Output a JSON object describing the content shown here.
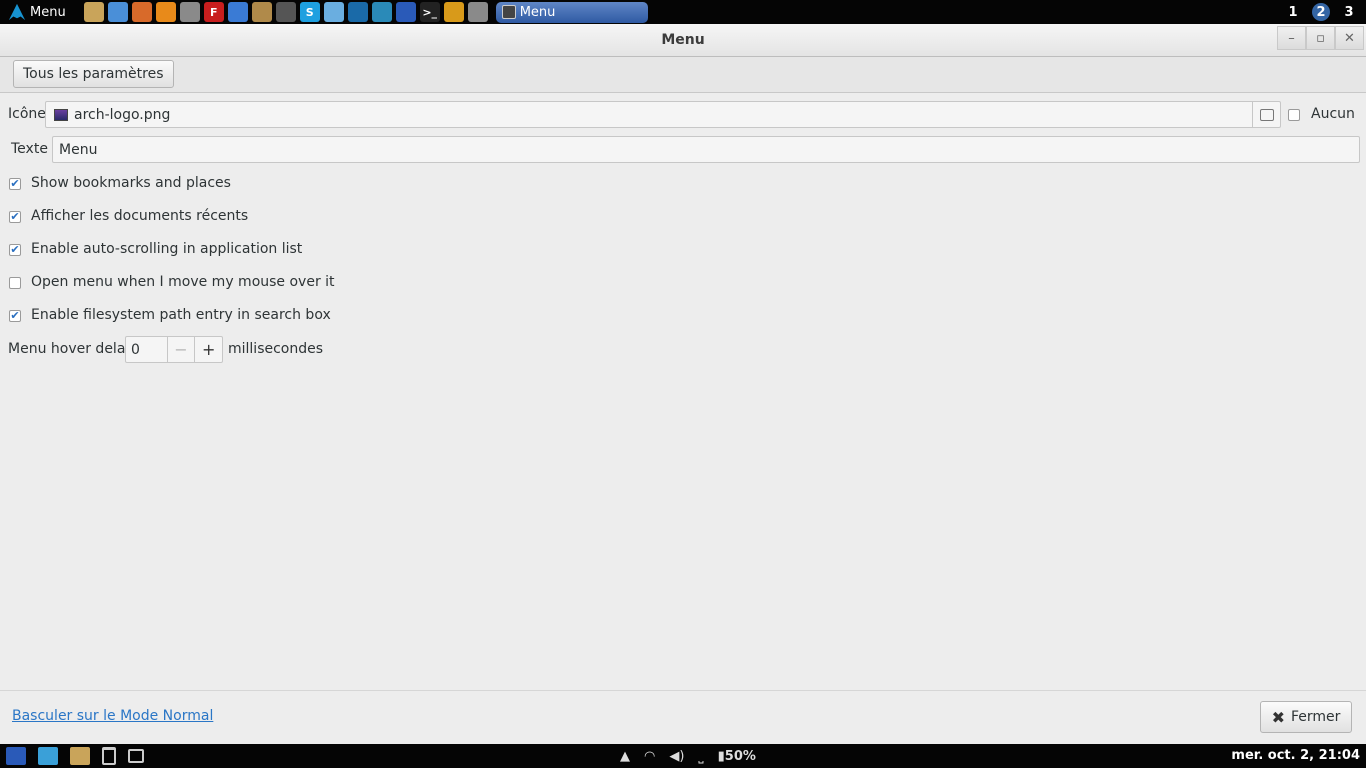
{
  "top_panel": {
    "menu_label": "Menu",
    "launchers": [
      {
        "icon": "folder-icon",
        "color": "#c9a45a",
        "glyph": ""
      },
      {
        "icon": "chromium-icon",
        "color": "#4a8fd8",
        "glyph": ""
      },
      {
        "icon": "image-viewer-icon",
        "color": "#d86a2a",
        "glyph": ""
      },
      {
        "icon": "vlc-icon",
        "color": "#e88a1a",
        "glyph": ""
      },
      {
        "icon": "screenshot-icon",
        "color": "#8a8a8a",
        "glyph": ""
      },
      {
        "icon": "filezilla-icon",
        "color": "#c81e1e",
        "glyph": "F"
      },
      {
        "icon": "document-icon",
        "color": "#3a7bd5",
        "glyph": ""
      },
      {
        "icon": "archive-icon",
        "color": "#b08a4a",
        "glyph": ""
      },
      {
        "icon": "scanner-icon",
        "color": "#555555",
        "glyph": ""
      },
      {
        "icon": "skype-icon",
        "color": "#1ea0e0",
        "glyph": "S"
      },
      {
        "icon": "display-icon",
        "color": "#6aaee0",
        "glyph": ""
      },
      {
        "icon": "wireshark-icon",
        "color": "#1a6aa8",
        "glyph": ""
      },
      {
        "icon": "network-icon",
        "color": "#2a8ab8",
        "glyph": ""
      },
      {
        "icon": "calculator-icon",
        "color": "#2a5ab8",
        "glyph": ""
      },
      {
        "icon": "terminal-icon",
        "color": "#222222",
        "glyph": ">_"
      },
      {
        "icon": "headphones-icon",
        "color": "#d89a1a",
        "glyph": ""
      },
      {
        "icon": "cloud-icon",
        "color": "#8a8a8a",
        "glyph": ""
      }
    ],
    "task_label": "Menu",
    "workspaces": [
      "1",
      "2",
      "3"
    ],
    "active_workspace": "2"
  },
  "window": {
    "title": "Menu",
    "toolbar": {
      "all_settings_label": "Tous les paramètres"
    },
    "icon_row": {
      "label": "Icône",
      "value": "arch-logo.png",
      "none_label": "Aucun",
      "none_checked": false
    },
    "text_row": {
      "label": "Texte",
      "value": "Menu"
    },
    "options": [
      {
        "label": "Show bookmarks and places",
        "checked": true
      },
      {
        "label": "Afficher les documents récents",
        "checked": true
      },
      {
        "label": "Enable auto-scrolling in application list",
        "checked": true
      },
      {
        "label": "Open menu when I move my mouse over it",
        "checked": false
      },
      {
        "label": "Enable filesystem path entry in search box",
        "checked": true
      }
    ],
    "hover_delay": {
      "label": "Menu hover delay",
      "value": "0",
      "unit": "millisecondes"
    },
    "footer": {
      "link_label": "Basculer sur le Mode Normal",
      "close_label": "Fermer"
    }
  },
  "bottom_panel": {
    "battery": "50%",
    "clock": "mer. oct.  2, 21:04"
  },
  "colors": {
    "accent": "#3465a4",
    "link": "#2a76c6",
    "check": "#2a6fc0"
  }
}
